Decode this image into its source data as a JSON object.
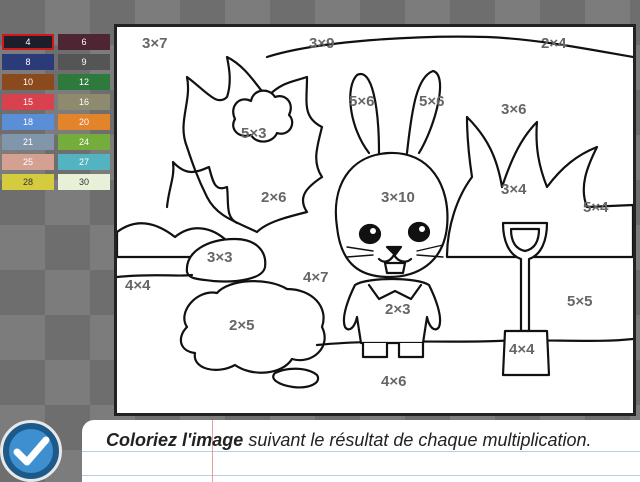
{
  "palette": [
    {
      "label": "4",
      "color": "#1c1f2b",
      "selected": true
    },
    {
      "label": "6",
      "color": "#4e2532"
    },
    {
      "label": "8",
      "color": "#2b3a78"
    },
    {
      "label": "9",
      "color": "#555555"
    },
    {
      "label": "10",
      "color": "#8a4a1e"
    },
    {
      "label": "12",
      "color": "#2e7a3c"
    },
    {
      "label": "15",
      "color": "#d9414e"
    },
    {
      "label": "16",
      "color": "#8e8a6e"
    },
    {
      "label": "18",
      "color": "#5a8fd8"
    },
    {
      "label": "20",
      "color": "#e3832a"
    },
    {
      "label": "21",
      "color": "#8296ab"
    },
    {
      "label": "24",
      "color": "#74ad3c"
    },
    {
      "label": "25",
      "color": "#d4a092"
    },
    {
      "label": "27",
      "color": "#53b3c0"
    },
    {
      "label": "28",
      "color": "#d4cb3e"
    },
    {
      "label": "30",
      "color": "#e8f0d8"
    }
  ],
  "regions": [
    {
      "label": "3×7"
    },
    {
      "label": "3×9"
    },
    {
      "label": "2×4"
    },
    {
      "label": "5×6"
    },
    {
      "label": "5×6"
    },
    {
      "label": "3×6"
    },
    {
      "label": "5×3"
    },
    {
      "label": "3×10"
    },
    {
      "label": "2×6"
    },
    {
      "label": "3×4"
    },
    {
      "label": "5×4"
    },
    {
      "label": "3×3"
    },
    {
      "label": "4×7"
    },
    {
      "label": "4×4"
    },
    {
      "label": "2×3"
    },
    {
      "label": "2×5"
    },
    {
      "label": "5×5"
    },
    {
      "label": "4×4"
    },
    {
      "label": "4×6"
    }
  ],
  "instruction": {
    "bold": "Coloriez l'image",
    "rest": " suivant le résultat de chaque multiplication."
  },
  "validate_button": {
    "icon": "checkmark-icon"
  }
}
